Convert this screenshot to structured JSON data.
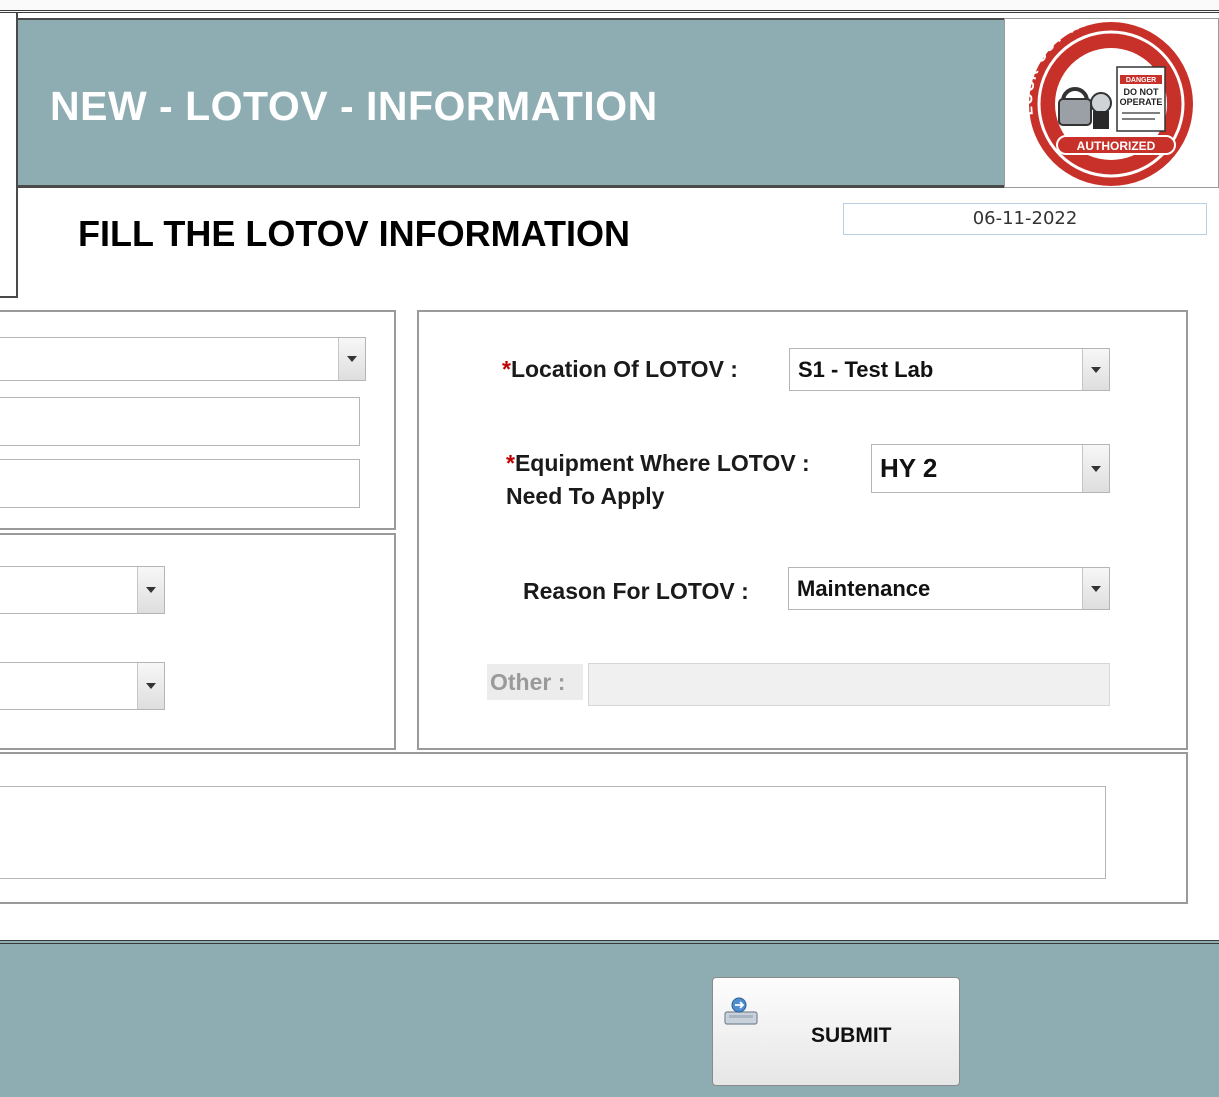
{
  "header": {
    "title": "NEW - LOTOV - INFORMATION",
    "logo": {
      "arc_text": "LOCK-OUT TAGOUT",
      "tag_danger": "DANGER",
      "tag_line1": "DO NOT",
      "tag_line2": "OPERATE",
      "banner": "AUTHORIZED",
      "icon": "lockout-tagout-seal-icon"
    }
  },
  "form": {
    "subtitle": "FILL THE LOTOV INFORMATION",
    "date": "06-11-2022",
    "location": {
      "required_mark": "*",
      "label": "Location Of LOTOV :",
      "value": "S1 - Test Lab"
    },
    "equipment": {
      "required_mark": "*",
      "label_line1": "Equipment Where LOTOV  :",
      "label_line2": "Need To Apply",
      "value": "HY 2"
    },
    "reason": {
      "label": "Reason For LOTOV :",
      "value": "Maintenance"
    },
    "other": {
      "label": "Other :",
      "value": ""
    },
    "left_combo_1": "",
    "left_field_1": "",
    "left_field_2": "",
    "left_combo_2": "",
    "left_combo_3": "",
    "remarks": ""
  },
  "footer": {
    "submit_label": "SUBMIT",
    "submit_icon": "save-tray-icon"
  },
  "colors": {
    "band": "#8eadb2",
    "required": "#c00000",
    "seal_red": "#c8312a"
  }
}
